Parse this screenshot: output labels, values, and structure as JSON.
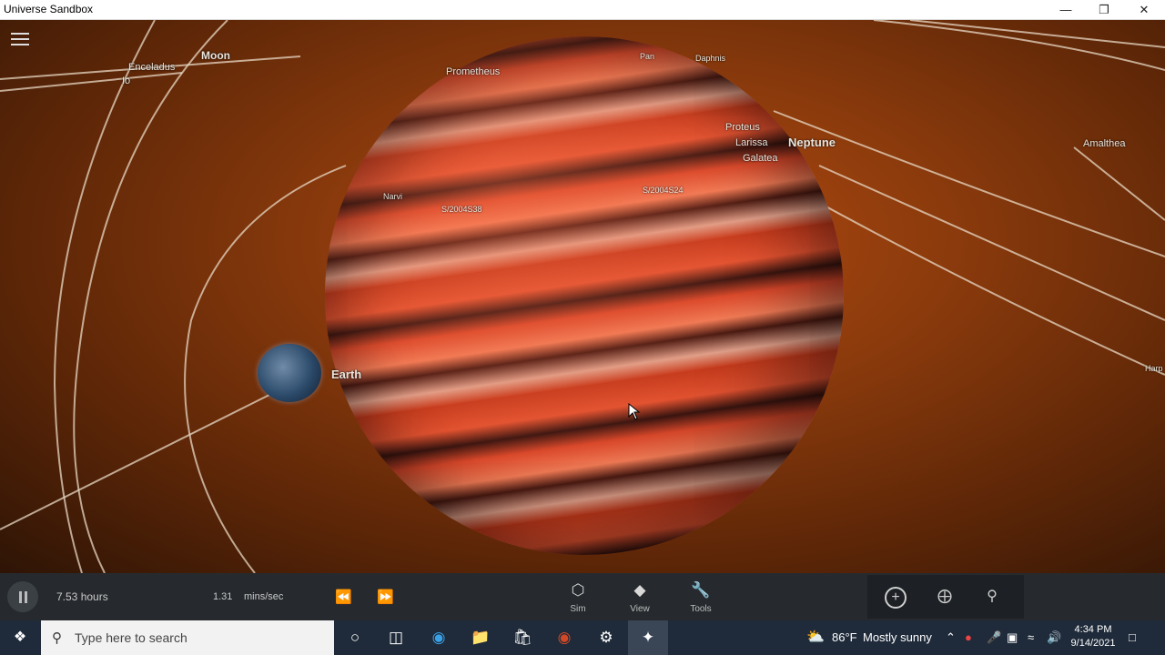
{
  "window": {
    "title": "Universe Sandbox",
    "minimize_icon": "minimize-icon",
    "restore_icon": "restore-icon",
    "close_icon": "close-icon"
  },
  "scene": {
    "labels": {
      "moon": "Moon",
      "enceladus": "Enceladus",
      "io": "Io",
      "prometheus": "Prometheus",
      "pan": "Pan",
      "daphnis": "Daphnis",
      "proteus": "Proteus",
      "larissa": "Larissa",
      "galatea": "Galatea",
      "neptune": "Neptune",
      "amalthea": "Amalthea",
      "narvi": "Narvi",
      "s2004s38": "S/2004S38",
      "s2004s24": "S/2004S24",
      "earth": "Earth",
      "harp": "Harp"
    }
  },
  "controls": {
    "elapsed": "7.53 hours",
    "speed_value": "1.31",
    "speed_unit": "mins/sec",
    "tools": [
      {
        "label": "Sim",
        "icon": "cube-icon"
      },
      {
        "label": "View",
        "icon": "layers-icon"
      },
      {
        "label": "Tools",
        "icon": "wrench-icon"
      }
    ]
  },
  "taskbar": {
    "search_placeholder": "Type here to search",
    "weather_temp": "86°F",
    "weather_text": "Mostly sunny",
    "time": "4:34 PM",
    "date": "9/14/2021"
  }
}
